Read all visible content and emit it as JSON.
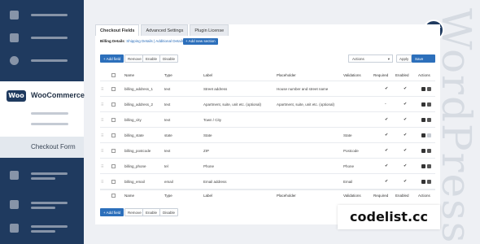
{
  "sidebar": {
    "brand": "WooCommerce",
    "brand_logo": "Woo",
    "active_item": "Checkout Form"
  },
  "watermark": "WordPress",
  "tabs": [
    "Checkout Fields",
    "Advanced Settings",
    "Plugin License"
  ],
  "section": {
    "label": "Billing Details",
    "links": "Shipping Details | Additional Details",
    "add_section": "+ Add new section"
  },
  "toolbar": {
    "add_field": "+ Add field",
    "remove": "Remove",
    "enable": "Enable",
    "disable": "Disable",
    "actions_select": "Actions",
    "apply": "Apply",
    "save": "Save changes"
  },
  "table": {
    "headers": [
      "Name",
      "Type",
      "Label",
      "Placeholder",
      "Validations",
      "Required",
      "Enabled",
      "Actions"
    ],
    "rows": [
      {
        "name": "billing_address_1",
        "type": "text",
        "label": "Street address",
        "placeholder": "House number and street name",
        "validations": "",
        "required": "✔",
        "enabled": "✔",
        "copy_disabled": false
      },
      {
        "name": "billing_address_2",
        "type": "text",
        "label": "Apartment, suite, unit etc. (optional)",
        "placeholder": "Apartment, suite, unit etc. (optional)",
        "validations": "",
        "required": "-",
        "enabled": "✔",
        "copy_disabled": false
      },
      {
        "name": "billing_city",
        "type": "text",
        "label": "Town / City",
        "placeholder": "",
        "validations": "",
        "required": "✔",
        "enabled": "✔",
        "copy_disabled": false
      },
      {
        "name": "billing_state",
        "type": "state",
        "label": "State",
        "placeholder": "",
        "validations": "State",
        "required": "✔",
        "enabled": "✔",
        "copy_disabled": true
      },
      {
        "name": "billing_postcode",
        "type": "text",
        "label": "ZIP",
        "placeholder": "",
        "validations": "Postcode",
        "required": "✔",
        "enabled": "✔",
        "copy_disabled": false
      },
      {
        "name": "billing_phone",
        "type": "tel",
        "label": "Phone",
        "placeholder": "",
        "validations": "Phone",
        "required": "✔",
        "enabled": "✔",
        "copy_disabled": false
      },
      {
        "name": "billing_email",
        "type": "email",
        "label": "Email address",
        "placeholder": "",
        "validations": "Email",
        "required": "✔",
        "enabled": "✔",
        "copy_disabled": false
      }
    ]
  },
  "banner": "codelist.cc",
  "colors": {
    "sidebar": "#1f3a5f",
    "primary": "#2c6fbb"
  }
}
